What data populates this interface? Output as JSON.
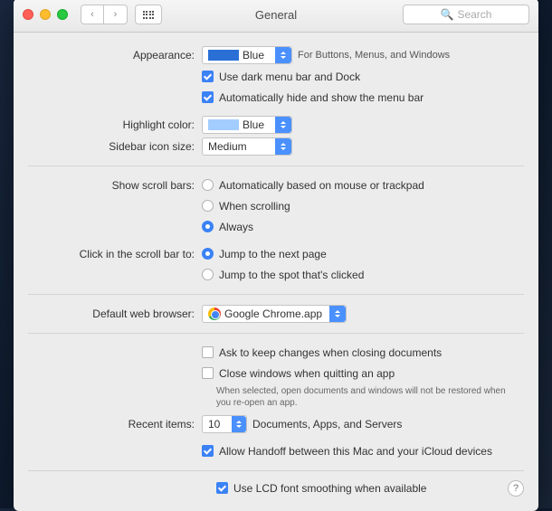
{
  "window": {
    "title": "General"
  },
  "search": {
    "placeholder": "Search"
  },
  "appearance": {
    "label": "Appearance:",
    "value": "Blue",
    "hint": "For Buttons, Menus, and Windows",
    "dark_menu": "Use dark menu bar and Dock",
    "auto_hide": "Automatically hide and show the menu bar"
  },
  "highlight": {
    "label": "Highlight color:",
    "value": "Blue"
  },
  "sidebar": {
    "label": "Sidebar icon size:",
    "value": "Medium"
  },
  "scrollbars": {
    "label": "Show scroll bars:",
    "opts": [
      "Automatically based on mouse or trackpad",
      "When scrolling",
      "Always"
    ]
  },
  "scrollclick": {
    "label": "Click in the scroll bar to:",
    "opts": [
      "Jump to the next page",
      "Jump to the spot that's clicked"
    ]
  },
  "browser": {
    "label": "Default web browser:",
    "value": "Google Chrome.app"
  },
  "docs": {
    "ask": "Ask to keep changes when closing documents",
    "close": "Close windows when quitting an app",
    "note": "When selected, open documents and windows will not be restored when you re-open an app."
  },
  "recent": {
    "label": "Recent items:",
    "value": "10",
    "suffix": "Documents, Apps, and Servers"
  },
  "handoff": "Allow Handoff between this Mac and your iCloud devices",
  "lcd": "Use LCD font smoothing when available"
}
